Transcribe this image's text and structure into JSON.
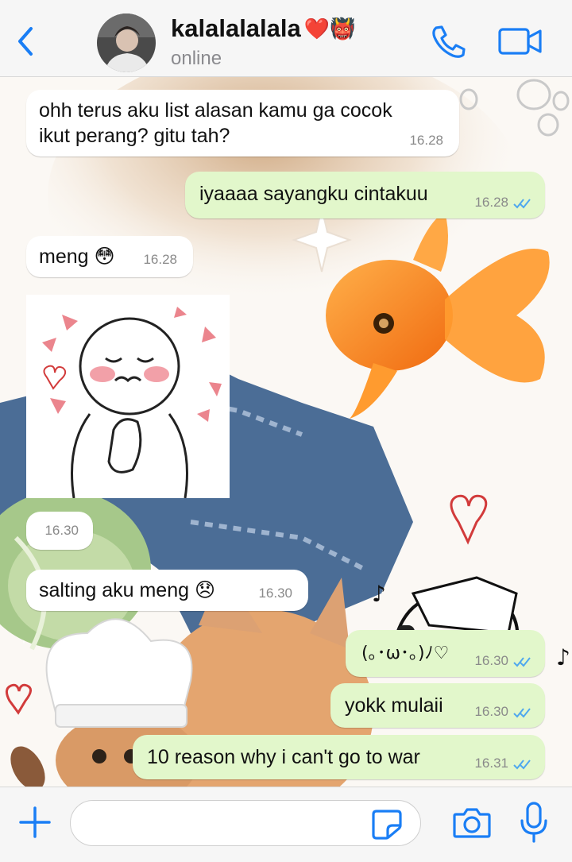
{
  "header": {
    "contact_name": "kalalalalala",
    "name_emojis": "❤️👹",
    "status": "online",
    "icons": {
      "back": "chevron-left-icon",
      "call": "phone-icon",
      "video": "video-camera-icon"
    }
  },
  "messages": [
    {
      "dir": "in",
      "text_lines": [
        "ohh terus aku list alasan kamu ga cocok",
        "ikut perang? gitu tah?"
      ],
      "time": "16.28"
    },
    {
      "dir": "out",
      "text": "iyaaaa sayangku cintakuu",
      "time": "16.28",
      "read": true
    },
    {
      "dir": "in",
      "text": "meng 😳",
      "time": "16.28"
    },
    {
      "dir": "in",
      "type": "sticker",
      "time": "16.30"
    },
    {
      "dir": "in",
      "text": "salting aku meng 😞",
      "time": "16.30"
    },
    {
      "dir": "out",
      "text": "(｡･ω･｡)ﾉ♡",
      "time": "16.30",
      "read": true
    },
    {
      "dir": "out",
      "text": "yokk mulaii",
      "time": "16.30",
      "read": true
    },
    {
      "dir": "out",
      "text": "10 reason why i can't go to war",
      "time": "16.31",
      "read": true
    }
  ],
  "input": {
    "placeholder": "",
    "value": ""
  },
  "colors": {
    "accent": "#1a7ef5",
    "outgoing_bubble": "#e2f7cb",
    "incoming_bubble": "#ffffff",
    "read_ticks": "#4fa8ee"
  }
}
